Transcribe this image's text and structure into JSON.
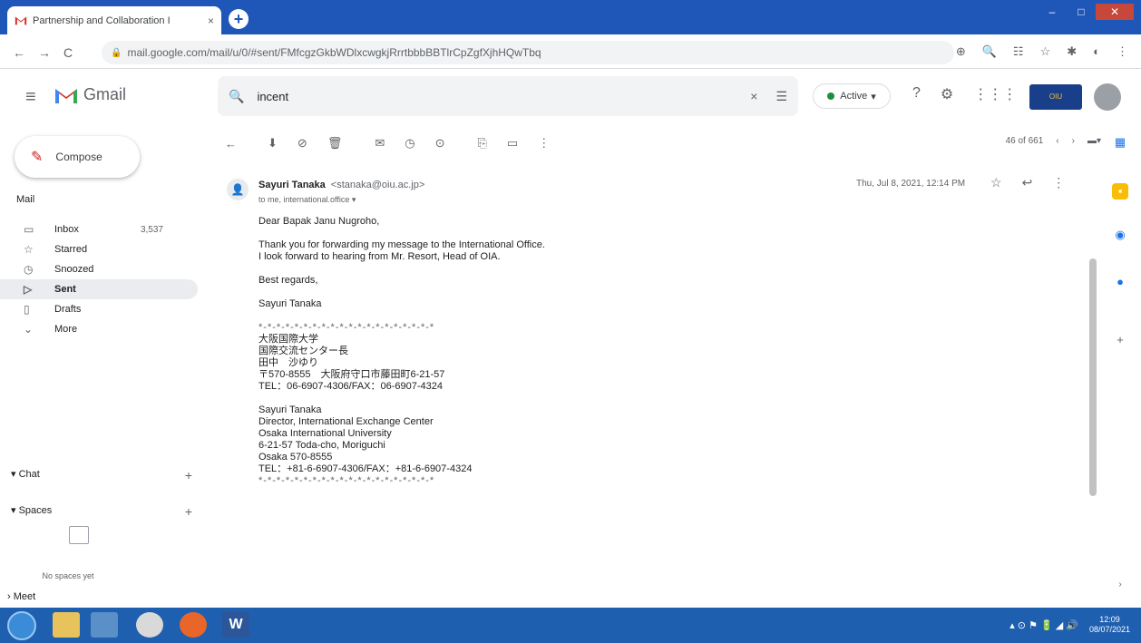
{
  "browser": {
    "tab_title": "Partnership and Collaboration I",
    "tab_close": "×",
    "new_tab": "+",
    "url": "mail.google.com/mail/u/0/#sent/FMfcgzGkbWDlxcwgkjRrrtbbbBBTlrCpZgfXjhHQwTbq",
    "window_controls": [
      "–",
      "□",
      "✕"
    ],
    "nav": {
      "back": "←",
      "forward": "→",
      "reload": "C"
    },
    "ext_icons": [
      "⊕",
      "🔍",
      "☷",
      "☆",
      "✱",
      "◐",
      "⋮"
    ]
  },
  "gmail": {
    "app_name": "Gmail",
    "search_query": "incent",
    "search_clear": "×",
    "status": "Active",
    "status_caret": "▾",
    "header_icons": [
      "?",
      "⚙",
      "⋮⋮⋮"
    ],
    "org_logo": "OIU"
  },
  "sidebar": {
    "compose_label": "Compose",
    "mail_label": "Mail",
    "items": [
      {
        "label": "Inbox",
        "count": "3,537",
        "icon": "inbox-icon",
        "glyph": "▭"
      },
      {
        "label": "Starred",
        "count": "",
        "icon": "star-icon",
        "glyph": "☆"
      },
      {
        "label": "Snoozed",
        "count": "",
        "icon": "clock-icon",
        "glyph": "◷"
      },
      {
        "label": "Sent",
        "count": "",
        "icon": "send-icon",
        "glyph": "▷"
      },
      {
        "label": "Drafts",
        "count": "",
        "icon": "draft-icon",
        "glyph": "▯"
      },
      {
        "label": "More",
        "count": "",
        "icon": "chevron-down-icon",
        "glyph": "⌄"
      }
    ],
    "chat_label": "Chat",
    "spaces_label": "Spaces",
    "spaces_empty": "No spaces yet",
    "meet_label": "Meet"
  },
  "toolbar": {
    "back": "←",
    "tools": [
      "⬇",
      "⊘",
      "🗑",
      "✉",
      "◷",
      "⊙",
      "⎘",
      "▭",
      "⋮"
    ],
    "pager": "46 of 661",
    "prev": "‹",
    "next": "›",
    "view": "▬▾"
  },
  "message": {
    "sender_name": "Sayuri Tanaka",
    "sender_email": "<stanaka@oiu.ac.jp>",
    "recipients": "to me, international.office ▾",
    "date": "Thu, Jul 8, 2021, 12:14 PM",
    "actions": [
      "☆",
      "↩",
      "⋮"
    ],
    "body_lines": [
      "Dear Bapak Janu Nugroho,",
      "",
      "Thank you for forwarding my message to the International Office.",
      "I look forward to hearing from Mr. Resort, Head of OIA.",
      "",
      "Best regards,",
      "",
      "Sayuri Tanaka",
      "",
      "*-*-*-*-*-*-*-*-*-*-*-*-*-*-*-*-*-*-*-*",
      "大阪国際大学",
      "国際交流センター長",
      "田中　沙ゆり",
      "〒570-8555　大阪府守口市藤田町6-21-57",
      "TEL：06-6907-4306/FAX：06-6907-4324",
      "",
      "Sayuri Tanaka",
      "Director, International Exchange Center",
      "Osaka International University",
      "6-21-57 Toda-cho, Moriguchi",
      "Osaka 570-8555",
      "TEL：+81-6-6907-4306/FAX：+81-6-6907-4324",
      "*-*-*-*-*-*-*-*-*-*-*-*-*-*-*-*-*-*-*-*"
    ]
  },
  "taskbar": {
    "clock_time": "12:09",
    "clock_date": "08/07/2021",
    "tray": "▴ ⊙ ⚑ 🔋 ◢ 🔊"
  },
  "colors": {
    "gmail_red": "#d93025",
    "taskbar_blue": "#1f5fb0",
    "tab_blue": "#1e57b8",
    "active_green": "#1e8e3e"
  }
}
